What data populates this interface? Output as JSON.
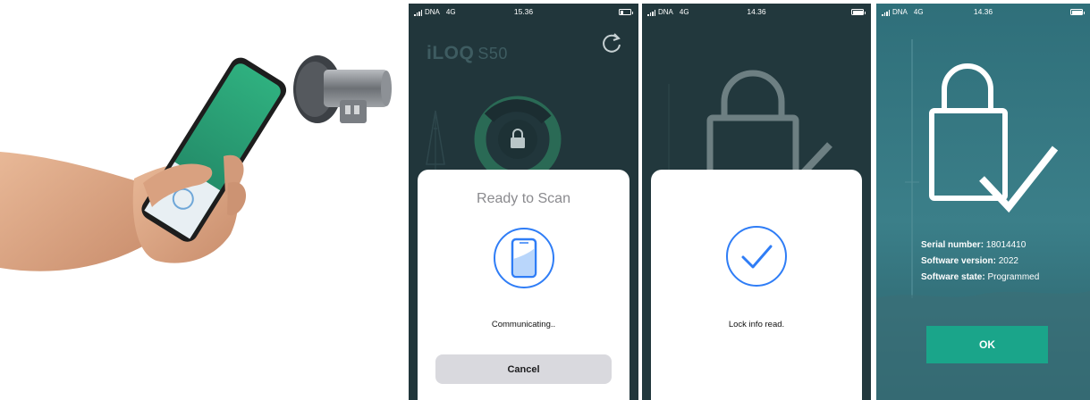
{
  "colors": {
    "dark_teal": "#253b40",
    "teal_accent": "#1aa58a",
    "ios_blue": "#2f7df6",
    "sheet_bg": "#ffffff",
    "button_gray": "#d9d9de"
  },
  "screens": [
    {
      "status": {
        "carrier": "DNA",
        "network": "4G",
        "time": "15.36",
        "battery_level": 0.35
      },
      "app": {
        "brand": "iLOQ",
        "model": "S50"
      },
      "sheet": {
        "title": "Ready to Scan",
        "icon": "phone-scan-icon",
        "status": "Communicating..",
        "cancel_label": "Cancel"
      }
    },
    {
      "status": {
        "carrier": "DNA",
        "network": "4G",
        "time": "14.36",
        "battery_level": 1.0
      },
      "sheet": {
        "icon": "checkmark-circle-icon",
        "status": "Lock info read."
      }
    },
    {
      "status": {
        "carrier": "DNA",
        "network": "4G",
        "time": "14.36",
        "battery_level": 1.0
      },
      "info": [
        {
          "label": "Serial number:",
          "value": "18014410"
        },
        {
          "label": "Software version:",
          "value": "2022"
        },
        {
          "label": "Software state:",
          "value": "Programmed"
        }
      ],
      "ok_label": "OK"
    }
  ]
}
